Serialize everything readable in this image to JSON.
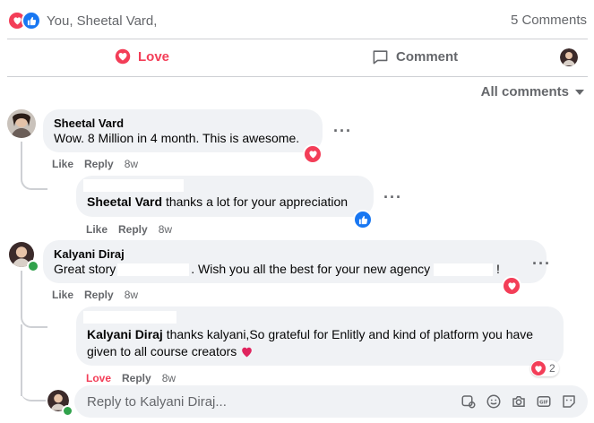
{
  "summary": {
    "reactors_text": "You, Sheetal Vard,",
    "comments_count": "5 Comments"
  },
  "actions": {
    "love_label": "Love",
    "comment_label": "Comment"
  },
  "filter": {
    "label": "All comments"
  },
  "comments": [
    {
      "author": "Sheetal Vard",
      "text": "Wow. 8 Million in 4 month. This is awesome.",
      "actions": [
        "Like",
        "Reply"
      ],
      "time": "8w",
      "reaction": "heart-icon",
      "reply": {
        "author": "Sheetal Vard",
        "text": "thanks a lot for your appreciation",
        "actions": [
          "Like",
          "Reply"
        ],
        "time": "8w",
        "reaction": "like-icon"
      }
    },
    {
      "author": "Kalyani Diraj",
      "text_start": "Great story",
      "text_middle": ". Wish you all the best for your new agency",
      "text_end": "!",
      "actions": [
        "Like",
        "Reply"
      ],
      "time": "8w",
      "reaction": "heart-icon",
      "reply": {
        "author": "Kalyani Diraj",
        "text": "thanks kalyani,So grateful for Enlitly and kind of platform you have given to all course creators",
        "actions": [
          "Love",
          "Reply"
        ],
        "time": "8w",
        "reaction": "heart-icon",
        "reaction_count": "2"
      }
    }
  ],
  "reply_input": {
    "placeholder": "Reply to Kalyani Diraj..."
  },
  "colors": {
    "love": "#f33e58",
    "like": "#1877f2",
    "muted": "#65676b",
    "bubble": "#f0f2f5"
  }
}
